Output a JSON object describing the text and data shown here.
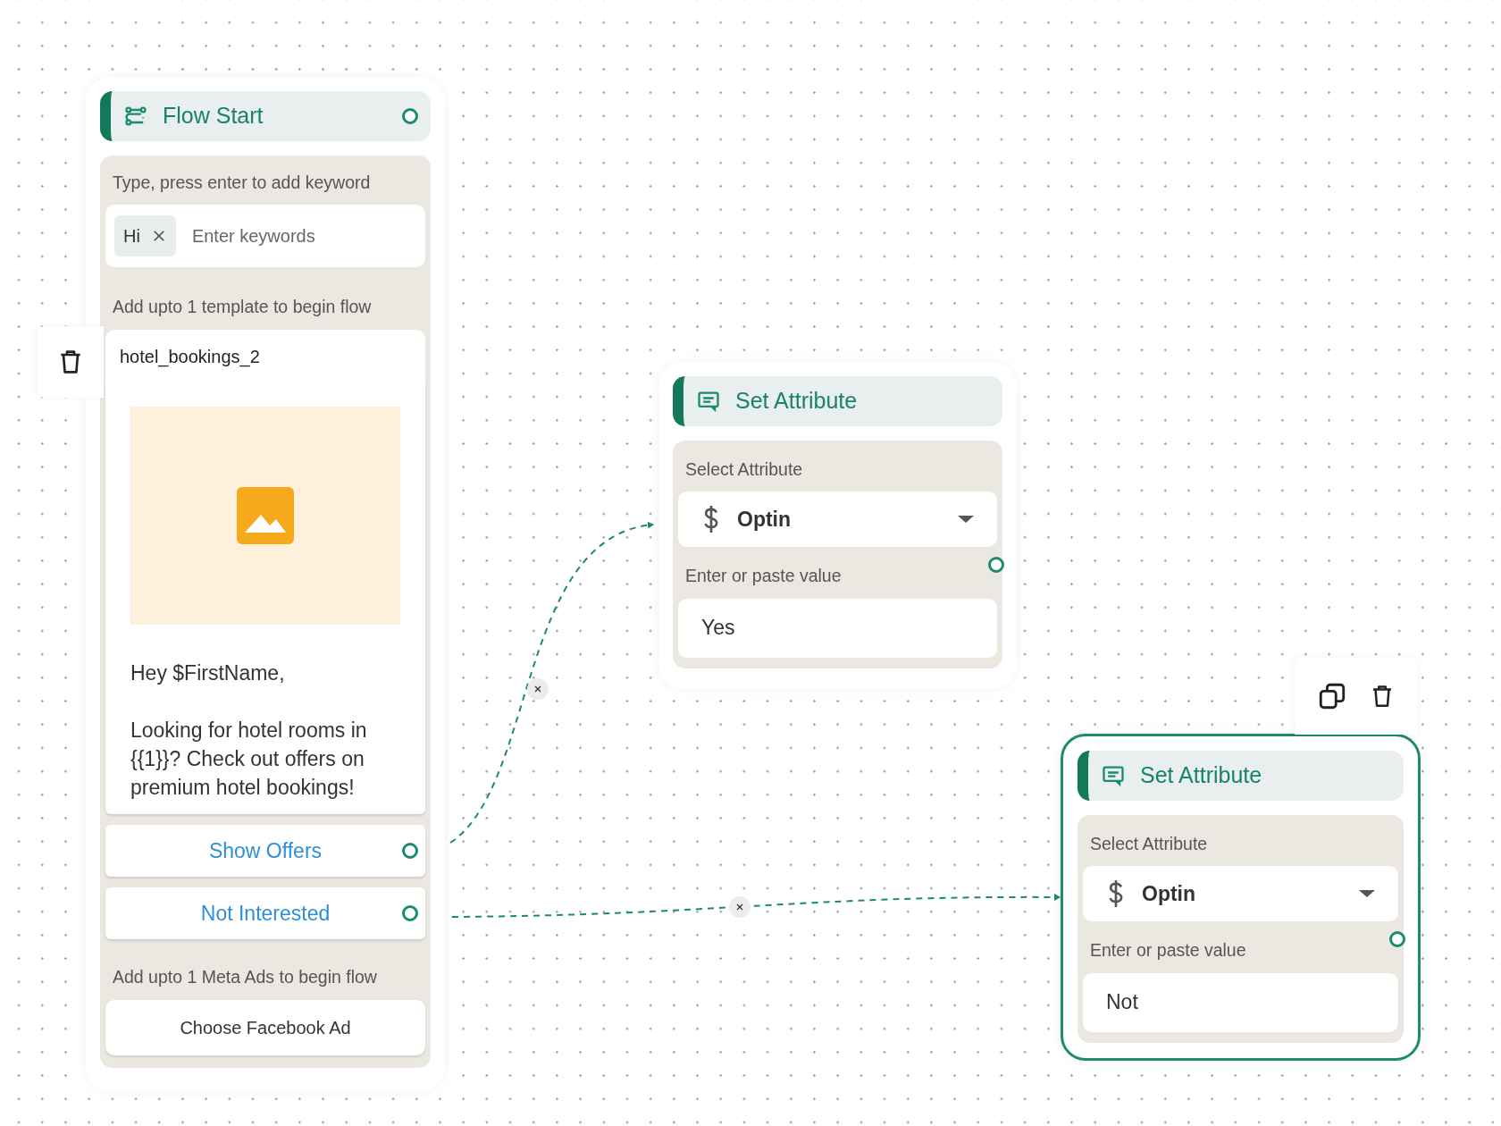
{
  "flow_start": {
    "title": "Flow Start",
    "keyword_label": "Type, press enter to add keyword",
    "keywords": [
      {
        "text": "Hi"
      }
    ],
    "keyword_placeholder": "Enter keywords",
    "template_label": "Add upto 1 template to begin flow",
    "template_name": "hotel_bookings_2",
    "template": {
      "kind": "picture",
      "message": "Hey $FirstName,\n\nLooking for hotel rooms in {{1}}? Check out offers on premium hotel bookings!",
      "buttons": [
        {
          "label": "Show Offers"
        },
        {
          "label": "Not Interested"
        }
      ]
    },
    "meta_ads_label": "Add upto 1 Meta Ads to begin flow",
    "meta_ads_button": "Choose Facebook Ad"
  },
  "set_attribute_nodes": [
    {
      "title": "Set Attribute",
      "select_label": "Select Attribute",
      "attribute": "Optin",
      "value_label": "Enter or paste value",
      "value": "Yes",
      "selected": false
    },
    {
      "title": "Set Attribute",
      "select_label": "Select Attribute",
      "attribute": "Optin",
      "value_label": "Enter or paste value",
      "value": "Not",
      "selected": true
    }
  ]
}
